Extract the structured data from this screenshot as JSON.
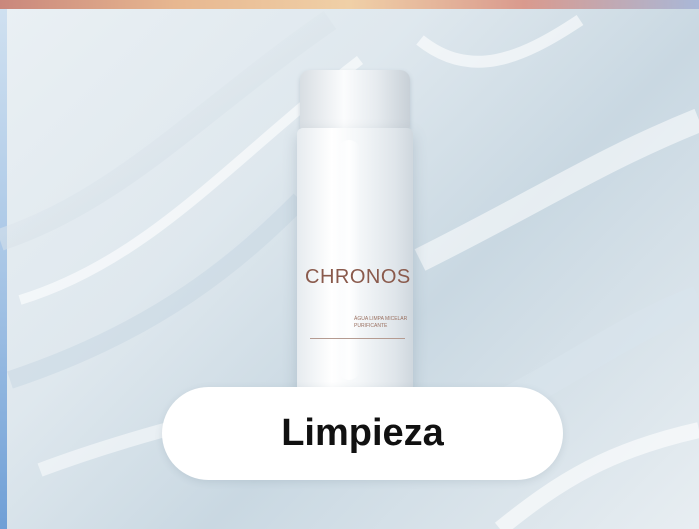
{
  "product": {
    "brand": "CHRONOS",
    "name": "ÁGUA LIMPA MICELAR PURIFICANTE"
  },
  "category": {
    "label": "Limpieza"
  },
  "colors": {
    "pill_background": "#ffffff",
    "label_text": "#111111",
    "brand_text": "#8a5a4c"
  }
}
